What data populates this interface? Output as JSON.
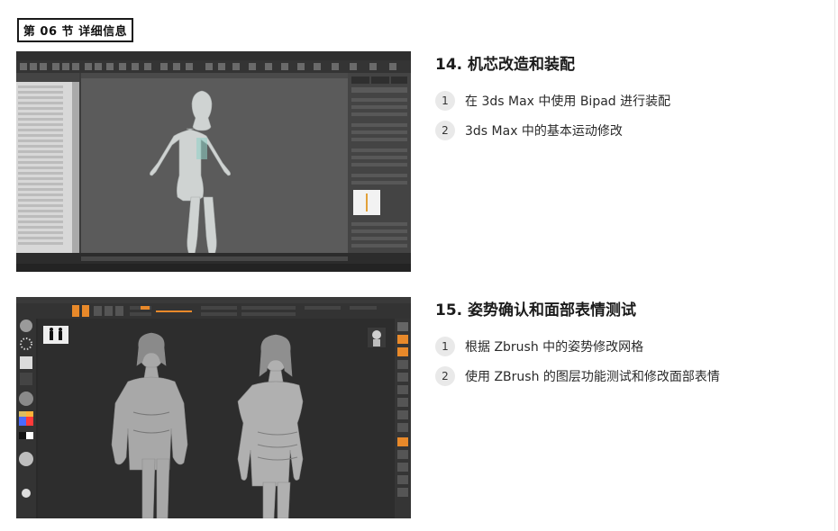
{
  "section": {
    "label": "第 06 节 详细信息"
  },
  "lessons": [
    {
      "title": "14. 机芯改造和装配",
      "items": [
        {
          "num": "1",
          "text": "在 3ds Max 中使用 Bipad 进行装配"
        },
        {
          "num": "2",
          "text": "3ds Max 中的基本运动修改"
        }
      ]
    },
    {
      "title": "15. 姿势确认和面部表情测试",
      "items": [
        {
          "num": "1",
          "text": "根据 Zbrush 中的姿势修改网格"
        },
        {
          "num": "2",
          "text": "使用 ZBrush 的图层功能测试和修改面部表情"
        }
      ]
    }
  ],
  "colors": {
    "max_viewport": "#5a5a5a",
    "max_panel": "#3a3a3a",
    "zbrush_bg": "#2b2b2b",
    "zbrush_accent": "#e8892a",
    "badge_bg": "#e9e9e9"
  },
  "icons": [
    "3dsmax-screenshot",
    "zbrush-screenshot",
    "character-model-icon"
  ]
}
